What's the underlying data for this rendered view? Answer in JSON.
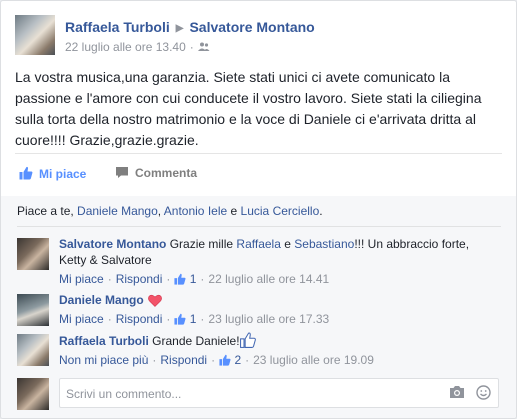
{
  "post": {
    "author": "Raffaela Turboli",
    "recipient": "Salvatore Montano",
    "timestamp": "22 luglio alle ore 13.40",
    "text": "La vostra musica,una garanzia. Siete stati unici ci avete comunicato la passione e l'amore con cui conducete il vostro lavoro. Siete stati la ciliegina sulla torta della nostro matrimonio e la voce di Daniele ci e'arrivata dritta al cuore!!!! Grazie,grazie.grazie."
  },
  "actions": {
    "like": "Mi piace",
    "comment": "Commenta"
  },
  "likes": {
    "prefix": "Piace a te,",
    "people": [
      "Daniele Mango",
      "Antonio Iele",
      "Lucia Cerciello"
    ],
    "comma": ",",
    "and": "e",
    "end": "."
  },
  "comments": [
    {
      "author": "Salvatore Montano",
      "text_before": "Grazie mille",
      "link1": "Raffaela",
      "and": "e",
      "link2": "Sebastiano",
      "text_after": "!!! Un abbraccio forte, Ketty & Salvatore",
      "like_action": "Mi piace",
      "reply": "Rispondi",
      "like_count": "1",
      "time": "22 luglio alle ore 14.41"
    },
    {
      "author": "Daniele Mango",
      "like_action": "Mi piace",
      "reply": "Rispondi",
      "like_count": "1",
      "time": "23 luglio alle ore 17.33"
    },
    {
      "author": "Raffaela Turboli",
      "text": "Grande Daniele!",
      "like_action": "Non mi piace più",
      "reply": "Rispondi",
      "like_count": "2",
      "time": "23 luglio alle ore 19.09"
    }
  ],
  "composer": {
    "placeholder": "Scrivi un commento..."
  },
  "colors": {
    "link": "#365899",
    "like_active": "#5890ff",
    "muted": "#90949c"
  }
}
